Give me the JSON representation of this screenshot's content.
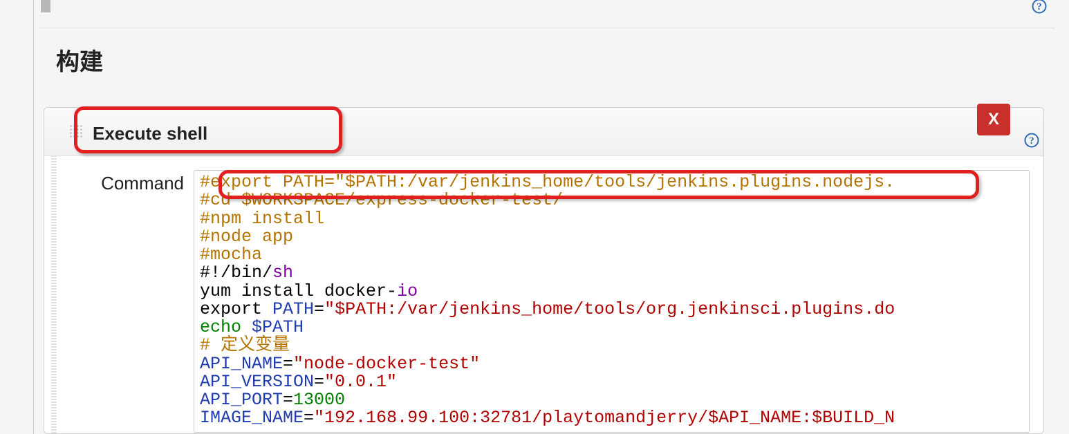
{
  "section": {
    "title": "构建"
  },
  "step": {
    "title": "Execute shell",
    "delete_label": "X",
    "command_label": "Command",
    "code": {
      "line1": "#export PATH=\"$PATH:/var/jenkins_home/tools/jenkins.plugins.nodejs.",
      "line2": "#cd $WORKSPACE/express-docker-test/",
      "line3": "#npm install",
      "line4": "#node app",
      "line5": "#mocha",
      "line6_a": "#!/bin/",
      "line6_b": "sh",
      "line7_a": "yum install docker",
      "line7_b": "-",
      "line7_c": "io",
      "line8_a": "export ",
      "line8_b": "PATH",
      "line8_c": "=",
      "line8_d": "\"$PATH:/var/jenkins_home/tools/org.jenkinsci.plugins.do",
      "line9_a": "echo",
      "line9_b": " $PATH",
      "line10": "# 定义变量",
      "line11_a": "API_NAME",
      "line11_b": "=",
      "line11_c": "\"node-docker-test\"",
      "line12_a": "API_VERSION",
      "line12_b": "=",
      "line12_c": "\"0.0.1\"",
      "line13_a": "API_PORT",
      "line13_b": "=",
      "line13_c": "13000",
      "line14_a": "IMAGE_NAME",
      "line14_b": "=",
      "line14_c": "\"192.168.99.100:32781/playtomandjerry/$API_NAME:$BUILD_N"
    }
  }
}
